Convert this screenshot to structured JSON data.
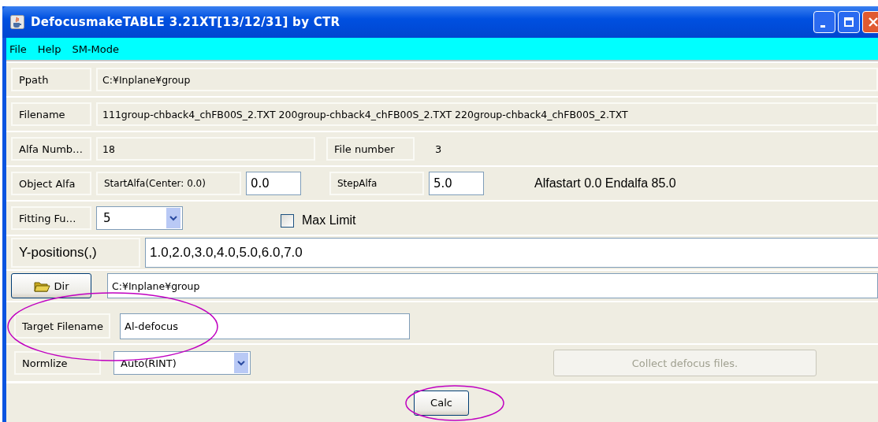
{
  "window": {
    "title": "DefocusmakeTABLE 3.21XT[13/12/31] by CTR"
  },
  "menu": [
    "File",
    "Help",
    "SM-Mode"
  ],
  "ppath": {
    "label": "Ppath",
    "value": "C:¥Inplane¥group"
  },
  "filename": {
    "label": "Filename",
    "value": "111group-chback4_chFB00S_2.TXT 200group-chback4_chFB00S_2.TXT 220group-chback4_chFB00S_2.TXT"
  },
  "alfa_number": {
    "label": "Alfa Numb…",
    "value": "18",
    "file_number_label": "File number",
    "file_number": "3"
  },
  "object_alfa": {
    "label": "Object Alfa",
    "start_label": "StartAlfa(Center: 0.0)",
    "start_value": "0.0",
    "step_label": "StepAlfa",
    "step_value": "5.0",
    "summary": "Alfastart 0.0 Endalfa 85.0"
  },
  "fitting": {
    "label": "Fitting Fu…",
    "value": "5"
  },
  "max_limit": {
    "label": "Max Limit",
    "checked": false
  },
  "y_positions": {
    "label": "Y-positions(,)",
    "value": "1.0,2.0,3.0,4.0,5.0,6.0,7.0"
  },
  "dir": {
    "button": "Dir",
    "value": "C:¥Inplane¥group"
  },
  "target": {
    "label": "Target Filename",
    "value": "Al-defocus"
  },
  "normalize": {
    "label": "Normlize",
    "value": "Auto(RINT)"
  },
  "collect_button": {
    "label": "Collect defocus files.",
    "disabled": true
  },
  "calc_button": {
    "label": "Calc"
  }
}
